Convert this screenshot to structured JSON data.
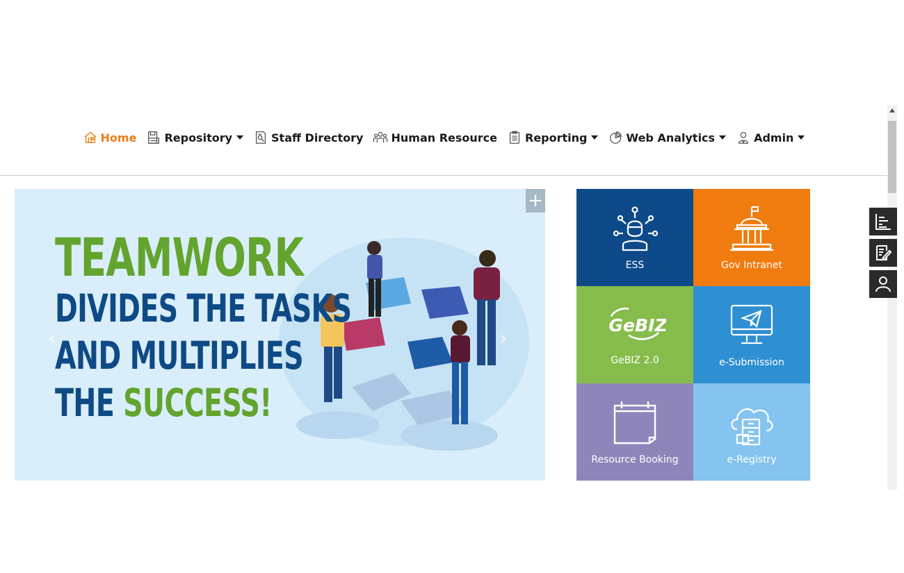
{
  "nav": {
    "items": [
      {
        "label": "Home",
        "icon": "home-icon",
        "active": true
      },
      {
        "label": "Repository",
        "icon": "repository-icon",
        "dropdown": true
      },
      {
        "label": "Staff Directory",
        "icon": "staff-directory-icon"
      },
      {
        "label": "Human Resource",
        "icon": "people-icon"
      },
      {
        "label": "Reporting",
        "icon": "clipboard-icon",
        "dropdown": true
      },
      {
        "label": "Web Analytics",
        "icon": "pie-chart-icon",
        "dropdown": true
      },
      {
        "label": "Admin",
        "icon": "admin-user-icon",
        "dropdown": true
      }
    ]
  },
  "banner": {
    "line1": "TEAMWORK",
    "line2": "DIVIDES THE TASKS",
    "line3": "AND MULTIPLIES",
    "line4_prefix": "THE ",
    "line4_highlight": "SUCCESS!",
    "plus_label": "+"
  },
  "tiles": [
    {
      "label": "ESS",
      "color": "#0e4a8a",
      "icon": "ess-network-user-icon"
    },
    {
      "label": "Gov Intranet",
      "color": "#f07b0f",
      "icon": "government-building-icon"
    },
    {
      "label": "GeBIZ 2.0",
      "logo": "GeBIZ",
      "color": "#86bc4c",
      "icon": "gebiz-logo-icon"
    },
    {
      "label": "e-Submission",
      "color": "#2e8fd3",
      "icon": "monitor-send-icon"
    },
    {
      "label": "Resource Booking",
      "color": "#8e86ba",
      "icon": "calendar-icon"
    },
    {
      "label": "e-Registry",
      "color": "#84c4ee",
      "icon": "cloud-cabinet-icon"
    }
  ],
  "side_buttons": [
    {
      "icon": "bar-list-icon"
    },
    {
      "icon": "edit-document-icon"
    },
    {
      "icon": "user-profile-icon"
    }
  ],
  "colors": {
    "accent_orange": "#ef7d1a",
    "banner_green": "#63a42e",
    "banner_navy": "#0e4a85"
  }
}
